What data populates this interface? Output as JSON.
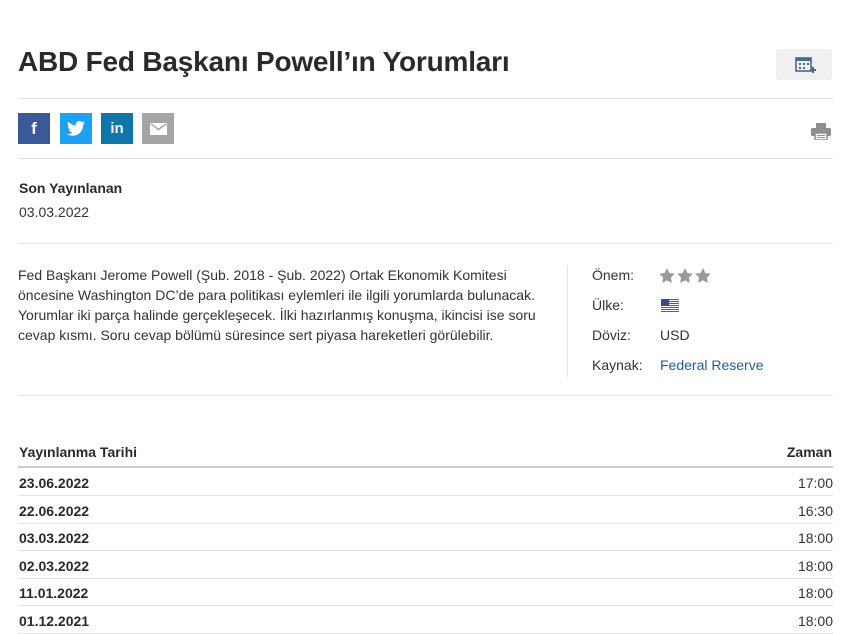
{
  "page": {
    "title": "ABD Fed Başkanı Powell’ın Yorumları"
  },
  "icons": {
    "add_to_calendar": "calendar-add-icon",
    "facebook": "facebook-icon",
    "twitter": "twitter-icon",
    "linkedin": "linkedin-icon",
    "email": "email-icon",
    "print": "print-icon"
  },
  "colors": {
    "facebook": "#3b5998",
    "twitter": "#1da1f2",
    "linkedin": "#0e76a8",
    "email": "#a5a5a5",
    "link": "#1f5fa6",
    "star_inactive": "#9a9a9a"
  },
  "share": {
    "facebook_glyph": "f",
    "linkedin_glyph": "in"
  },
  "latest": {
    "label": "Son Yayınlanan",
    "date": "03.03.2022"
  },
  "description": "Fed Başkanı Jerome Powell (Şub. 2018 - Şub. 2022) Ortak Ekonomik Komitesi öncesine Washington DC’de para politikası eylemleri ile ilgili yorumlarda bulunacak. Yorumlar iki parça halinde gerçekleşecek. İlki hazırlanmış konuşma, ikincisi ise soru cevap kısmı. Soru cevap bölümü süresince sert piyasa hareketleri görülebilir.",
  "info": {
    "importance_label": "Önem:",
    "importance_stars": 3,
    "country_label": "Ülke:",
    "country_flag": "us-flag-icon",
    "currency_label": "Döviz:",
    "currency_value": "USD",
    "source_label": "Kaynak:",
    "source_value": "Federal Reserve"
  },
  "history": {
    "col_date": "Yayınlanma Tarihi",
    "col_time": "Zaman",
    "rows": [
      {
        "date": "23.06.2022",
        "time": "17:00"
      },
      {
        "date": "22.06.2022",
        "time": "16:30"
      },
      {
        "date": "03.03.2022",
        "time": "18:00"
      },
      {
        "date": "02.03.2022",
        "time": "18:00"
      },
      {
        "date": "11.01.2022",
        "time": "18:00"
      },
      {
        "date": "01.12.2021",
        "time": "18:00"
      }
    ]
  }
}
